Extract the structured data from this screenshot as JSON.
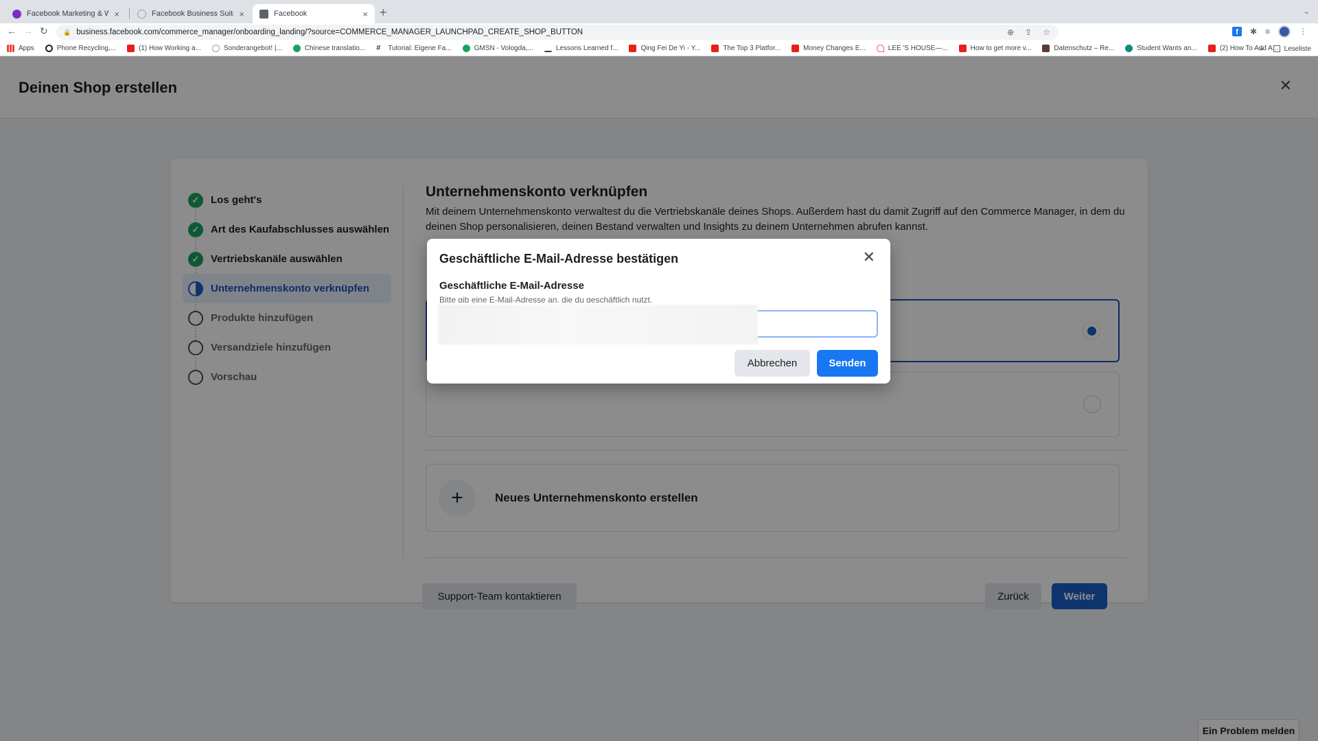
{
  "browser": {
    "tabs": [
      {
        "title": "Facebook Marketing & Werbea",
        "favicon_color": "#7b2fbe",
        "active": false
      },
      {
        "title": "Facebook Business Suite",
        "favicon_color": "#9aa0a6",
        "active": false
      },
      {
        "title": "Facebook",
        "favicon_color": "#5f6368",
        "active": true
      }
    ],
    "new_tab_icon": "+",
    "url": "business.facebook.com/commerce_manager/onboarding_landing/?source=COMMERCE_MANAGER_LAUNCHPAD_CREATE_SHOP_BUTTON",
    "bookmarks": [
      {
        "label": "Apps",
        "icon_color": "#ea4335"
      },
      {
        "label": "Phone Recycling,...",
        "icon_color": "#1c1e21"
      },
      {
        "label": "(1) How Working a...",
        "icon_color": "#e62117"
      },
      {
        "label": "Sonderangebot! |...",
        "icon_color": "#9aa0a6"
      },
      {
        "label": "Chinese translatio...",
        "icon_color": "#1aa260"
      },
      {
        "label": "Tutorial: Eigene Fa...",
        "icon_color": "#3c4043"
      },
      {
        "label": "GMSN - Vologda,...",
        "icon_color": "#1aa260"
      },
      {
        "label": "Lessons Learned f...",
        "icon_color": "#3c4043"
      },
      {
        "label": "Qing Fei De Yi - Y...",
        "icon_color": "#e62117"
      },
      {
        "label": "The Top 3 Platfor...",
        "icon_color": "#e62117"
      },
      {
        "label": "Money Changes E...",
        "icon_color": "#e62117"
      },
      {
        "label": "LEE 'S HOUSE—...",
        "icon_color": "#ff5a5f"
      },
      {
        "label": "How to get more v...",
        "icon_color": "#e62117"
      },
      {
        "label": "Datenschutz – Re...",
        "icon_color": "#5a3b30"
      },
      {
        "label": "Student Wants an...",
        "icon_color": "#128c7e"
      },
      {
        "label": "(2) How To Add A...",
        "icon_color": "#e62117"
      }
    ],
    "bookmarks_overflow": "»",
    "reading_list": "Leseliste"
  },
  "page": {
    "title": "Deinen Shop erstellen",
    "steps": [
      {
        "label": "Los geht's",
        "state": "done"
      },
      {
        "label": "Art des Kaufabschlusses auswählen",
        "state": "done"
      },
      {
        "label": "Vertriebskanäle auswählen",
        "state": "done"
      },
      {
        "label": "Unternehmenskonto verknüpfen",
        "state": "current"
      },
      {
        "label": "Produkte hinzufügen",
        "state": "todo"
      },
      {
        "label": "Versandziele hinzufügen",
        "state": "todo"
      },
      {
        "label": "Vorschau",
        "state": "todo"
      }
    ],
    "section_title": "Unternehmenskonto verknüpfen",
    "section_description": "Mit deinem Unternehmenskonto verwaltest du die Vertriebskanäle deines Shops. Außerdem hast du damit Zugriff auf den Commerce Manager, in dem du deinen Shop personalisieren, deinen Bestand verwalten und Insights zu deinem Unternehmen abrufen kannst.",
    "options": [
      {
        "selected": true
      },
      {
        "selected": false
      }
    ],
    "create_account_label": "Neues Unternehmenskonto erstellen",
    "support_button": "Support-Team kontaktieren",
    "back_button": "Zurück",
    "next_button": "Weiter",
    "report_problem": "Ein Problem melden"
  },
  "modal": {
    "title": "Geschäftliche E-Mail-Adresse bestätigen",
    "field_label": "Geschäftliche E-Mail-Adresse",
    "field_hint": "Bitte gib eine E-Mail-Adresse an, die du geschäftlich nutzt.",
    "email_value": "",
    "cancel_button": "Abbrechen",
    "send_button": "Senden"
  },
  "colors": {
    "brand_blue": "#1877f2",
    "step_done": "#1aa260",
    "step_current": "#1b5fc9"
  }
}
